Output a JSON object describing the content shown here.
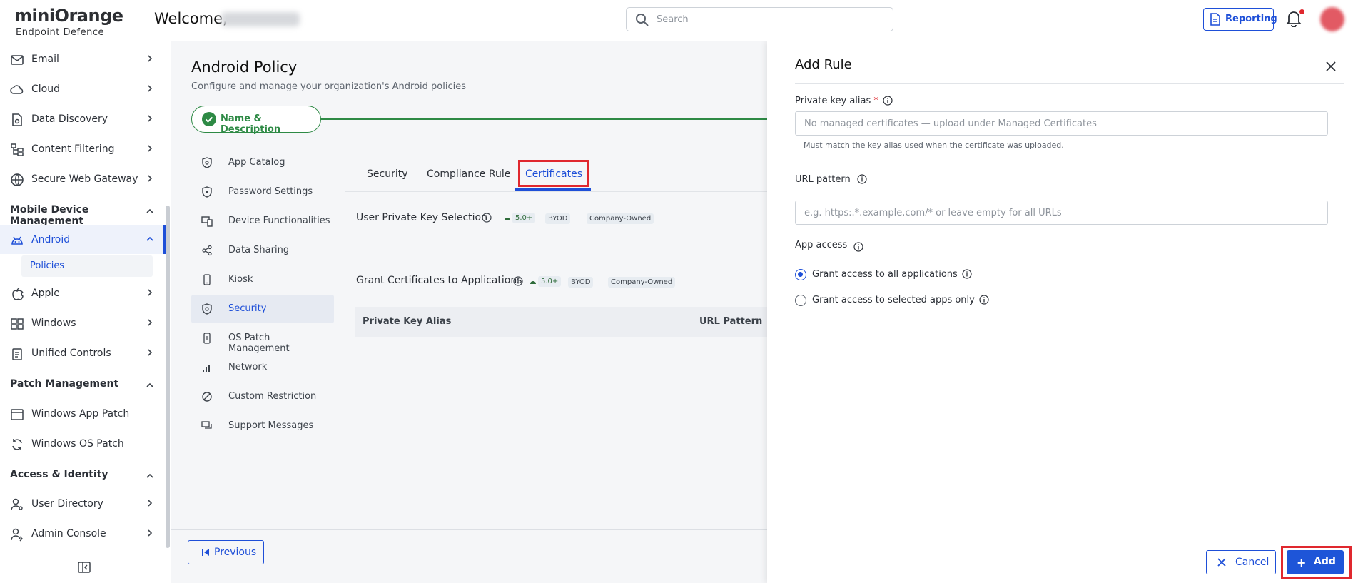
{
  "header": {
    "brand": "miniOrange",
    "product": "Endpoint Defence",
    "welcome": "Welcome,",
    "search_placeholder": "Search",
    "reporting_label": "Reporting"
  },
  "sidebar": {
    "items": [
      {
        "label": "Email"
      },
      {
        "label": "Cloud"
      },
      {
        "label": "Data Discovery"
      },
      {
        "label": "Content Filtering"
      },
      {
        "label": "Secure Web Gateway"
      }
    ],
    "section_mdm": "Mobile Device Management",
    "android": "Android",
    "policies": "Policies",
    "apple": "Apple",
    "windows": "Windows",
    "unified_controls": "Unified Controls",
    "section_patch": "Patch Management",
    "windows_app_patch": "Windows App Patch",
    "windows_os_patch": "Windows OS Patch",
    "section_access": "Access & Identity",
    "user_directory": "User Directory",
    "admin_console": "Admin Console"
  },
  "main": {
    "title": "Android Policy",
    "subtitle": "Configure and manage your organization's Android policies",
    "step_label": "Name & Description",
    "menu": [
      {
        "label": "App Catalog"
      },
      {
        "label": "Password Settings"
      },
      {
        "label": "Device Functionalities"
      },
      {
        "label": "Data Sharing"
      },
      {
        "label": "Kiosk"
      },
      {
        "label": "Security"
      },
      {
        "label": "OS Patch Management"
      },
      {
        "label": "Network"
      },
      {
        "label": "Custom Restriction"
      },
      {
        "label": "Support Messages"
      }
    ],
    "tabs": [
      {
        "label": "Security"
      },
      {
        "label": "Compliance Rule"
      },
      {
        "label": "Certificates"
      }
    ],
    "section1_title": "User Private Key Selection",
    "section2_title": "Grant Certificates to Applications",
    "badge_version": "5.0+",
    "badge_byod": "BYOD",
    "badge_company": "Company-Owned",
    "table_col1": "Private Key Alias",
    "table_col2": "URL Pattern",
    "previous_label": "Previous"
  },
  "drawer": {
    "title": "Add Rule",
    "private_key_label": "Private key alias",
    "required_mark": "*",
    "private_key_placeholder": "No managed certificates — upload under Managed Certificates",
    "private_key_help": "Must match the key alias used when the certificate was uploaded.",
    "url_pattern_label": "URL pattern",
    "url_pattern_placeholder": "e.g. https:.*.example.com/* or leave empty for all URLs",
    "app_access_label": "App access",
    "radio_all": "Grant access to all applications",
    "radio_selected": "Grant access to selected apps only",
    "cancel_label": "Cancel",
    "add_label": "Add"
  },
  "colors": {
    "accent": "#1e4fd8",
    "success": "#2e8a45",
    "highlight": "#e0282e"
  }
}
